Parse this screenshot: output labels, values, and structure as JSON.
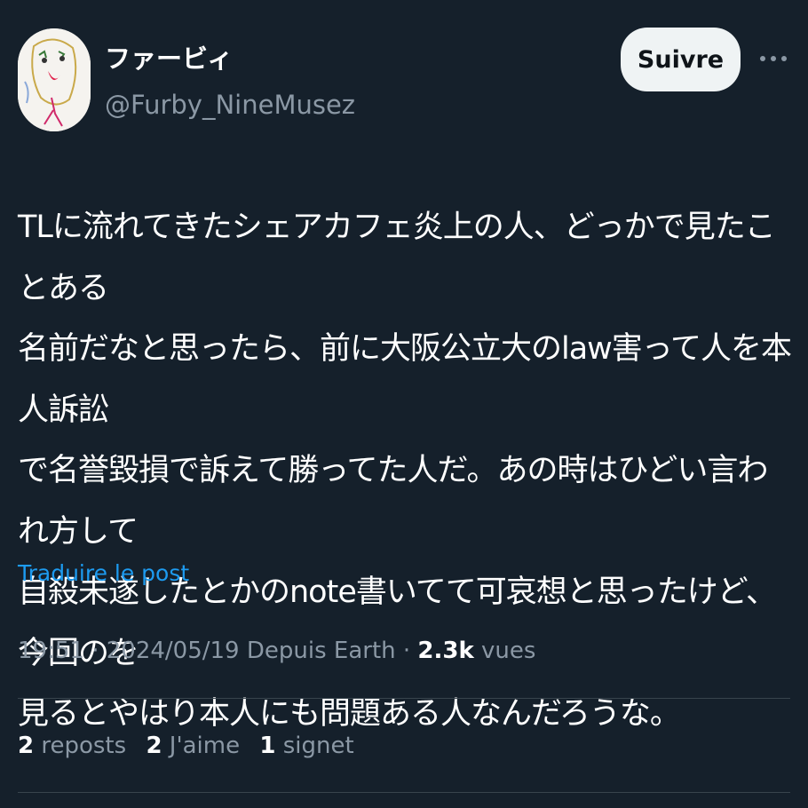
{
  "header": {
    "display_name": "ファービィ",
    "handle": "@Furby_NineMusez",
    "follow_label": "Suivre",
    "more_icon": "more-horizontal-icon",
    "avatar_icon": "avatar-drawing"
  },
  "tweet": {
    "text": "TLに流れてきたシェアカフェ炎上の人、どっかで見たことある\n名前だなと思ったら、前に大阪公立大のlaw害って人を本人訴訟\nで名誉毀損で訴えて勝ってた人だ。あの時はひどい言われ方して\n自殺未遂したとかのnote書いてて可哀想と思ったけど、今回のを\n見るとやはり本人にも問題ある人なんだろうな。",
    "translate_label": "Traduire le post"
  },
  "meta": {
    "time": "19:51",
    "separator": "·",
    "date": "2024/05/19",
    "source": "Depuis Earth",
    "views_count": "2.3k",
    "views_label": "vues"
  },
  "stats": {
    "reposts_count": "2",
    "reposts_label": "reposts",
    "likes_count": "2",
    "likes_label": "J'aime",
    "bookmarks_count": "1",
    "bookmarks_label": "signet"
  },
  "colors": {
    "background": "#15202b",
    "text": "#ffffff",
    "secondary": "#8b98a5",
    "link": "#1d9bf0",
    "button_bg": "#eff3f4",
    "divider": "#38444d"
  }
}
